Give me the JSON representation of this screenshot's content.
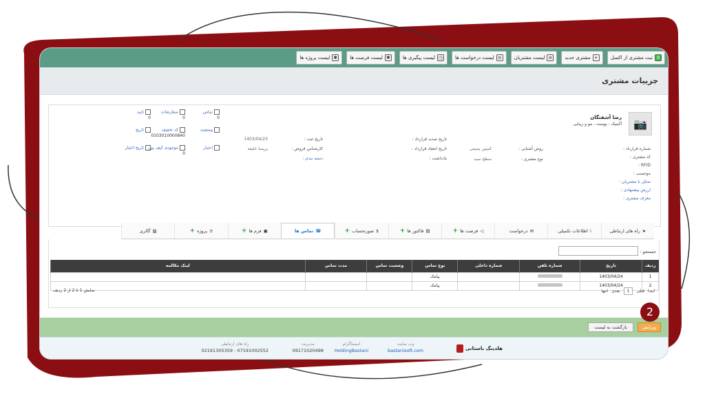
{
  "toolbar": [
    {
      "label": "ثبت مشتری از اکسل",
      "icon": "excel-icon"
    },
    {
      "label": "مشتری جدید",
      "icon": "add-customer-icon"
    },
    {
      "label": "لیست مشتریان",
      "icon": "list-icon"
    },
    {
      "label": "لیست درخواست ها",
      "icon": "list-icon"
    },
    {
      "label": "لیست پیگیری ها",
      "icon": "clock-icon"
    },
    {
      "label": "لیست فرصت ها",
      "icon": "lightbulb-icon"
    },
    {
      "label": "لیست پروژه ها",
      "icon": "lightbulb-icon"
    }
  ],
  "page": {
    "title": "جزییات مشتری"
  },
  "customer": {
    "name": "رضا آشفتگان",
    "sub": "آکبنیک - پوست ، مو و زیبایی",
    "fields": [
      {
        "label": "شماره قرارداد :",
        "value": ""
      },
      {
        "label": "کد مشتری :",
        "value": ""
      },
      {
        "label": "RFID :",
        "value": ""
      },
      {
        "label": "موجسب :",
        "value": ""
      },
      {
        "label": "تمایل با مشتریان :",
        "value": ""
      },
      {
        "label": "ارزش پیشنهادی :",
        "value": ""
      },
      {
        "label": "معرف مشتری :",
        "value": ""
      }
    ],
    "col2": [
      {
        "label": "روش آشنایی :",
        "value": "کمپین پسیتی"
      },
      {
        "label": "نوع مشتری :",
        "value": "سطح سید"
      }
    ],
    "col3": [
      {
        "label": "تاریخ تمدید قرارداد :",
        "value": ""
      },
      {
        "label": "تاریخ انعقاد قرارداد :",
        "value": ""
      },
      {
        "label": "یادداشت :",
        "value": ""
      }
    ],
    "col4": [
      {
        "label": "تاریخ ثبت :",
        "value": "1403/04/23"
      },
      {
        "label": "کارشناس فروش :",
        "value": "پریسا خلیفه"
      },
      {
        "label": "دسته بندی :",
        "value": ""
      }
    ],
    "quick": [
      {
        "label": "تماس",
        "count": "0"
      },
      {
        "label": "سفارشات",
        "count": "0"
      },
      {
        "label": "تایید",
        "count": "0"
      },
      {
        "label": "وضعیت",
        "count": ""
      },
      {
        "label": "کد تخفیف",
        "count": "0103010000840"
      },
      {
        "label": "تاریخ",
        "count": ""
      },
      {
        "label": "اعتبار",
        "count": ""
      },
      {
        "label": "موجودی کیف پول",
        "count": "0"
      },
      {
        "label": "تاریخ اعتبار",
        "count": ""
      }
    ]
  },
  "tabs": [
    {
      "label": "راه های ارتباطی",
      "icon": "send-icon",
      "plus": false,
      "active": false
    },
    {
      "label": "اطلاعات تکمیلی",
      "icon": "info-icon",
      "plus": false,
      "active": false
    },
    {
      "label": "درخواست",
      "icon": "chat-icon",
      "plus": false,
      "active": false
    },
    {
      "label": "فرصت ها",
      "icon": "megaphone-icon",
      "plus": true,
      "active": false
    },
    {
      "label": "فاکتور ها",
      "icon": "invoice-icon",
      "plus": true,
      "active": false
    },
    {
      "label": "صورتحساب",
      "icon": "dollar-icon",
      "plus": true,
      "active": false
    },
    {
      "label": "تماس ها",
      "icon": "phone-icon",
      "plus": false,
      "active": true
    },
    {
      "label": "فرم ها",
      "icon": "form-icon",
      "plus": true,
      "active": false
    },
    {
      "label": "پروژه",
      "icon": "list-icon",
      "plus": true,
      "active": false
    },
    {
      "label": "گالری",
      "icon": "image-icon",
      "plus": false,
      "active": false
    }
  ],
  "calls": {
    "search_label": "جستجو :",
    "columns": [
      "ردیف",
      "تاریخ",
      "شماره تلفن",
      "شماره داخلی",
      "نوع تماس",
      "وضعیت تماس",
      "مدت تماس",
      "لینک مکالمه"
    ],
    "rows": [
      [
        "1",
        "1403/04/24",
        "",
        "",
        "پیامک",
        "",
        "",
        ""
      ],
      [
        "2",
        "1403/04/24",
        "",
        "",
        "پیامک",
        "",
        "",
        ""
      ]
    ],
    "pager": {
      "first": "ابتدا",
      "prev": "قبلی",
      "page": "1",
      "next": "بعدی",
      "last": "انتها"
    },
    "info": "نمایش 1 تا 2 از 2 ردیف"
  },
  "actions": {
    "edit": "ویرایش",
    "back": "بازگشت به لیست"
  },
  "footer": {
    "brand": "هلدینگ باستانی",
    "cols": [
      {
        "label": "وب سایت",
        "value": "bastanisoft.com",
        "color": "#1a56b8"
      },
      {
        "label": "اینستاگرام",
        "value": "HoldingBastani",
        "color": "#1a56b8"
      },
      {
        "label": "مدیریت",
        "value": "09171020498",
        "color": "#333333"
      },
      {
        "label": "راه های ارتباطی",
        "value": "07191002552 - 02191305359",
        "color": "#333333"
      }
    ]
  },
  "step": "2",
  "colors": {
    "topbar": "#5a9c86",
    "frame": "#8b0f12",
    "active_tab": "#1e73c8",
    "edit_button": "#f0ad4e"
  }
}
